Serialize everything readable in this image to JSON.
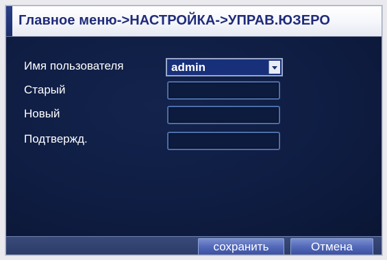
{
  "window": {
    "title": "Главное меню->НАСТРОЙКА->УПРАВ.ЮЗЕРО"
  },
  "form": {
    "username_label": "Имя пользователя",
    "username_value": "admin",
    "old_label": "Старый",
    "old_value": "",
    "new_label": "Новый",
    "new_value": "",
    "confirm_label": "Подтвержд.",
    "confirm_value": ""
  },
  "buttons": {
    "save_label": "сохранить",
    "cancel_label": "Отмена"
  },
  "colors": {
    "title_text": "#1f2b79",
    "panel_background": "#0f1d43",
    "field_border": "#4d6ea9",
    "button_fill": "#5268b8"
  },
  "icons": {
    "dropdown": "chevron-down-icon"
  }
}
